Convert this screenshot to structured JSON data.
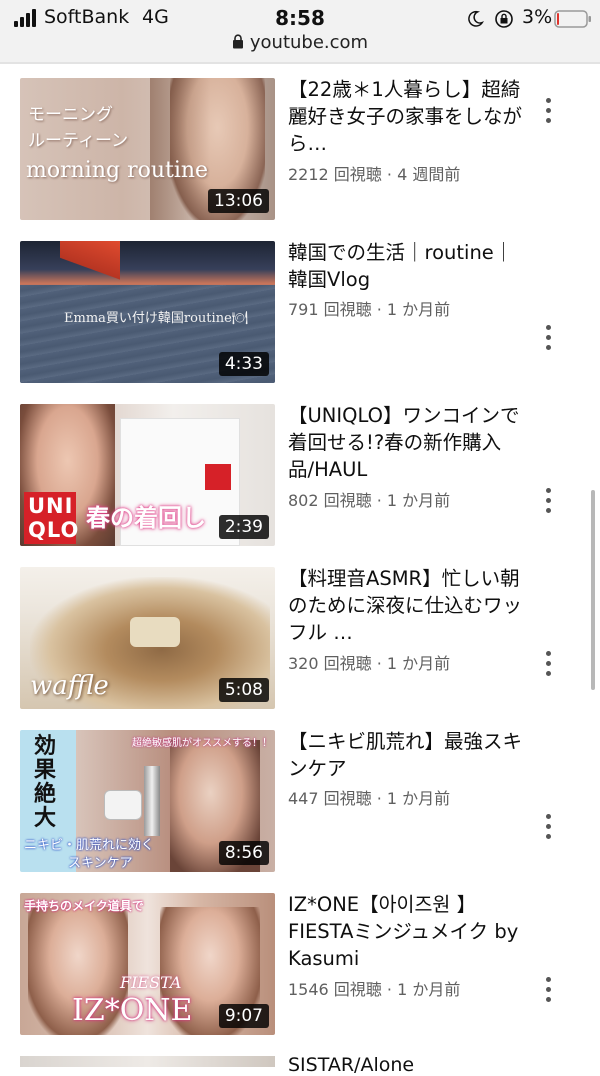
{
  "status_bar": {
    "carrier": "SoftBank",
    "network": "4G",
    "time": "8:58",
    "battery": "3%",
    "url": "youtube.com"
  },
  "videos": [
    {
      "title": "【22歳＊1人暮らし】超綺麗好き女子の家事をしながら…",
      "meta": "2212 回視聴 · 4 週間前",
      "duration": "13:06",
      "thumb_text": [
        "モーニング",
        "ルーティーン",
        "morning routine"
      ]
    },
    {
      "title": "韓国での生活｜routine｜韓国Vlog",
      "meta": "791 回視聴 · 1 か月前",
      "duration": "4:33",
      "thumb_text": [
        "Emma買い付け韓国routine🍽"
      ]
    },
    {
      "title": "【UNIQLO】ワンコインで着回せる!?春の新作購入品/HAUL",
      "meta": "802 回視聴 · 1 か月前",
      "duration": "2:39",
      "thumb_text": [
        "UNI",
        "QLO",
        "春の着回し"
      ]
    },
    {
      "title": "【料理音ASMR】忙しい朝のために深夜に仕込むワッフル …",
      "meta": "320 回視聴 · 1 か月前",
      "duration": "5:08",
      "thumb_text": [
        "waffle"
      ]
    },
    {
      "title": "【ニキビ肌荒れ】最強スキンケア",
      "meta": "447 回視聴 · 1 か月前",
      "duration": "8:56",
      "thumb_text": [
        "効果絶大",
        "超絶敏感肌がオススメする！！",
        "ニキビ・肌荒れに効く",
        "スキンケア"
      ]
    },
    {
      "title": "IZ*ONE【아이즈원 】FIESTAミンジュメイク by Kasumi",
      "meta": "1546 回視聴 · 1 か月前",
      "duration": "9:07",
      "thumb_text": [
        "手持ちのメイク道具で",
        "FIESTA",
        "IZ*ONE"
      ]
    }
  ],
  "partial_next_title": "SISTAR/Alone"
}
